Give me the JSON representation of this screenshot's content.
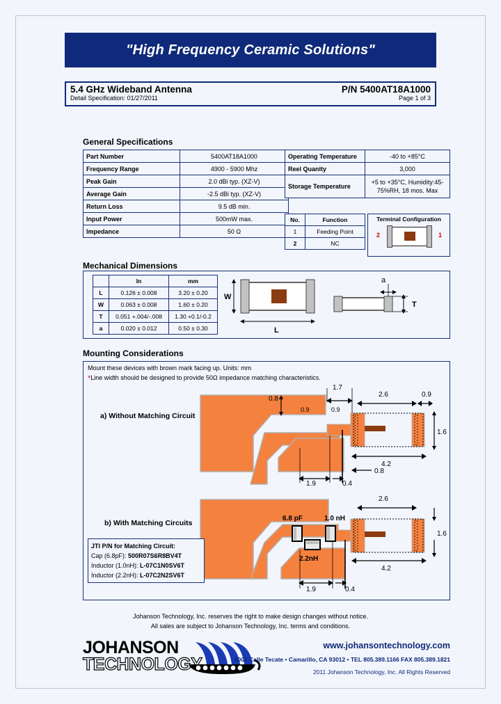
{
  "banner": {
    "tagline": "\"High Frequency Ceramic Solutions\""
  },
  "title": {
    "product": "5.4 GHz Wideband Antenna",
    "part_number": "P/N 5400AT18A1000",
    "spec_label": "Detail Specification:",
    "spec_date": "01/27/2011",
    "page": "Page 1 of 3"
  },
  "general_specs": {
    "heading": "General Specifications",
    "rows": [
      {
        "label": "Part Number",
        "value": "5400AT18A1000"
      },
      {
        "label": "Frequency Range",
        "value": "4900 - 5900 Mhz"
      },
      {
        "label": "Peak Gain",
        "value": "2.0  dBi typ. (XZ-V)"
      },
      {
        "label": "Average Gain",
        "value": "-2.5  dBi typ. (XZ-V)"
      },
      {
        "label": "Return Loss",
        "value": "9.5 dB min."
      },
      {
        "label": "Input Power",
        "value": "500mW max."
      },
      {
        "label": "Impedance",
        "value": "50 Ω"
      }
    ]
  },
  "environment": {
    "rows": [
      {
        "label": "Operating Temperature",
        "value": "-40 to +85°C"
      },
      {
        "label": "Reel Quanity",
        "value": "3,000"
      },
      {
        "label": "Storage Temperature",
        "value": "+5 to +35°C, Humidity:45-75%RH, 18 mos. Max"
      }
    ]
  },
  "terminal": {
    "headers": [
      "No.",
      "Function"
    ],
    "rows": [
      {
        "no": "1",
        "function": "Feeding Point"
      },
      {
        "no": "2",
        "function": "NC"
      }
    ],
    "config_title": "Terminal Configuration",
    "pin_left": "2",
    "pin_right": "1"
  },
  "mechanical": {
    "heading": "Mechanical Dimensions",
    "headers": [
      "",
      "In",
      "mm"
    ],
    "rows": [
      {
        "ref": "L",
        "in": "0.126  ±  0.008",
        "mm": "3.20  ±  0.20"
      },
      {
        "ref": "W",
        "in": "0.063  ±  0.008",
        "mm": "1.60  ±  0.20"
      },
      {
        "ref": "T",
        "in": "0.051  +.004/-.008",
        "mm": "1.30   +0.1/-0.2"
      },
      {
        "ref": "a",
        "in": "0.020  ±  0.012",
        "mm": "0.50  ±  0.30"
      }
    ],
    "drawing_labels": {
      "w": "W",
      "l": "L",
      "t": "T",
      "a": "a"
    }
  },
  "mounting": {
    "heading": "Mounting Considerations",
    "note1": "Mount these devices with brown mark facing up. Units: mm",
    "note2": "Line width should be designed to provide 50Ω impedance matching characteristics.",
    "diagram_a_label": "a) Without Matching Circuit",
    "diagram_b_label": "b) With Matching Circuits",
    "dims_a": {
      "d1": "1.7",
      "d2": "0.8",
      "d3": "0.9",
      "d4": "0.9",
      "d5": "2.6",
      "d6": "0.9",
      "d7": "1.6",
      "d8": "4.2",
      "d9": "0.8",
      "d10": "1.9",
      "d11": "0.4"
    },
    "dims_b": {
      "d1": "2.6",
      "d2": "1.6",
      "d3": "4.2",
      "d4": "1.9",
      "d5": "0.4",
      "cap": "6.8 pF",
      "ind1": "1.0 nH",
      "ind2": "2.2nH"
    },
    "jti_box": {
      "title": "JTI P/N for Matching Circuit:",
      "cap_label": "Cap (6.8pF): ",
      "cap_pn": "500R07S6R8BV4T",
      "ind1_label": "Inductor (1.0nH): ",
      "ind1_pn": "L-07C1N0SV6T",
      "ind2_label": "Inductor (2.2nH): ",
      "ind2_pn": "L-07C2N2SV6T"
    }
  },
  "footer": {
    "disclaimer1": "Johanson Technology, Inc. reserves the right to make design changes without notice.",
    "disclaimer2": "All sales are subject to Johanson Technology, Inc. terms and conditions.",
    "logo_line1": "JOHANSON",
    "logo_line2": "TECHNOLOGY",
    "website": "www.johansontechnology.com",
    "address": "4001 Calle Tecate • Camarillo, CA 93012 • TEL 805.389.1166 FAX 805.389.1821",
    "copyright": "2011 Johanson Technology, Inc.  All Rights Reserved"
  },
  "colors": {
    "brand_blue": "#0f2a7a",
    "copper": "#f5813f",
    "copper_shadow": "#b0b0b0",
    "mark_brown": "#8c3a10",
    "accent_red": "#d60000",
    "asterisk_magenta": "#d6007f"
  }
}
